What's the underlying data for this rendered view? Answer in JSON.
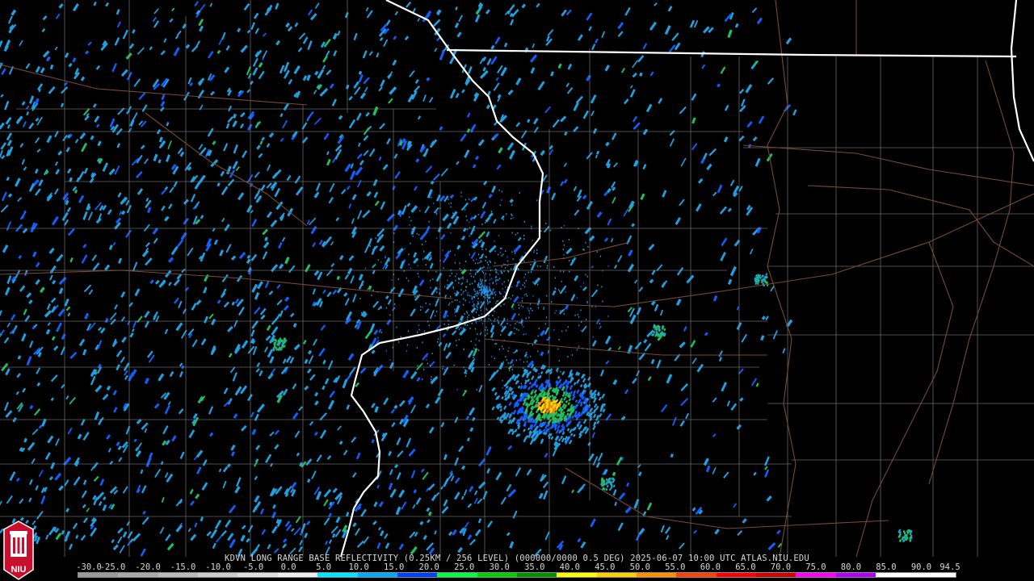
{
  "caption": "KDVN LONG RANGE BASE REFLECTIVITY (0.25KM / 256 LEVEL) (000000/0000 0.5 DEG) 2025-06-07 10:00 UTC  ATLAS.NIU.EDU",
  "scale": {
    "labels": [
      "-30.0",
      "-25.0",
      "-20.0",
      "-15.0",
      "-10.0",
      "-5.0",
      "0.0",
      "5.0",
      "10.0",
      "15.0",
      "20.0",
      "25.0",
      "30.0",
      "35.0",
      "40.0",
      "45.0",
      "50.0",
      "55.0",
      "60.0",
      "65.0",
      "70.0",
      "75.0",
      "80.0",
      "85.0",
      "90.0",
      "94.5"
    ],
    "colors": [
      "#9a9a9a",
      "#aaaaaa",
      "#bbbbbb",
      "#cccccc",
      "#dddddd",
      "#eeeeee",
      "#00e8ff",
      "#00a8ff",
      "#0040ff",
      "#00ff40",
      "#00d000",
      "#009000",
      "#ffff00",
      "#ffd000",
      "#ff9000",
      "#ff4000",
      "#ff0000",
      "#d00000",
      "#ff00ff",
      "#b000ff",
      "#ffffff",
      "#ffffff"
    ]
  },
  "logo": {
    "text": "NIU",
    "colors": {
      "red": "#c8102e",
      "white": "#ffffff"
    }
  },
  "map": {
    "colors": {
      "background": "#000000",
      "state_border": "#ffffff",
      "county_line": "#8a8a8a",
      "highway": "#7a4a30",
      "echo_light": "#1fa0e0",
      "echo_blue": "#1060ff",
      "echo_green": "#20c060",
      "echo_yellow": "#f0e000",
      "echo_orange": "#ff8000"
    }
  }
}
